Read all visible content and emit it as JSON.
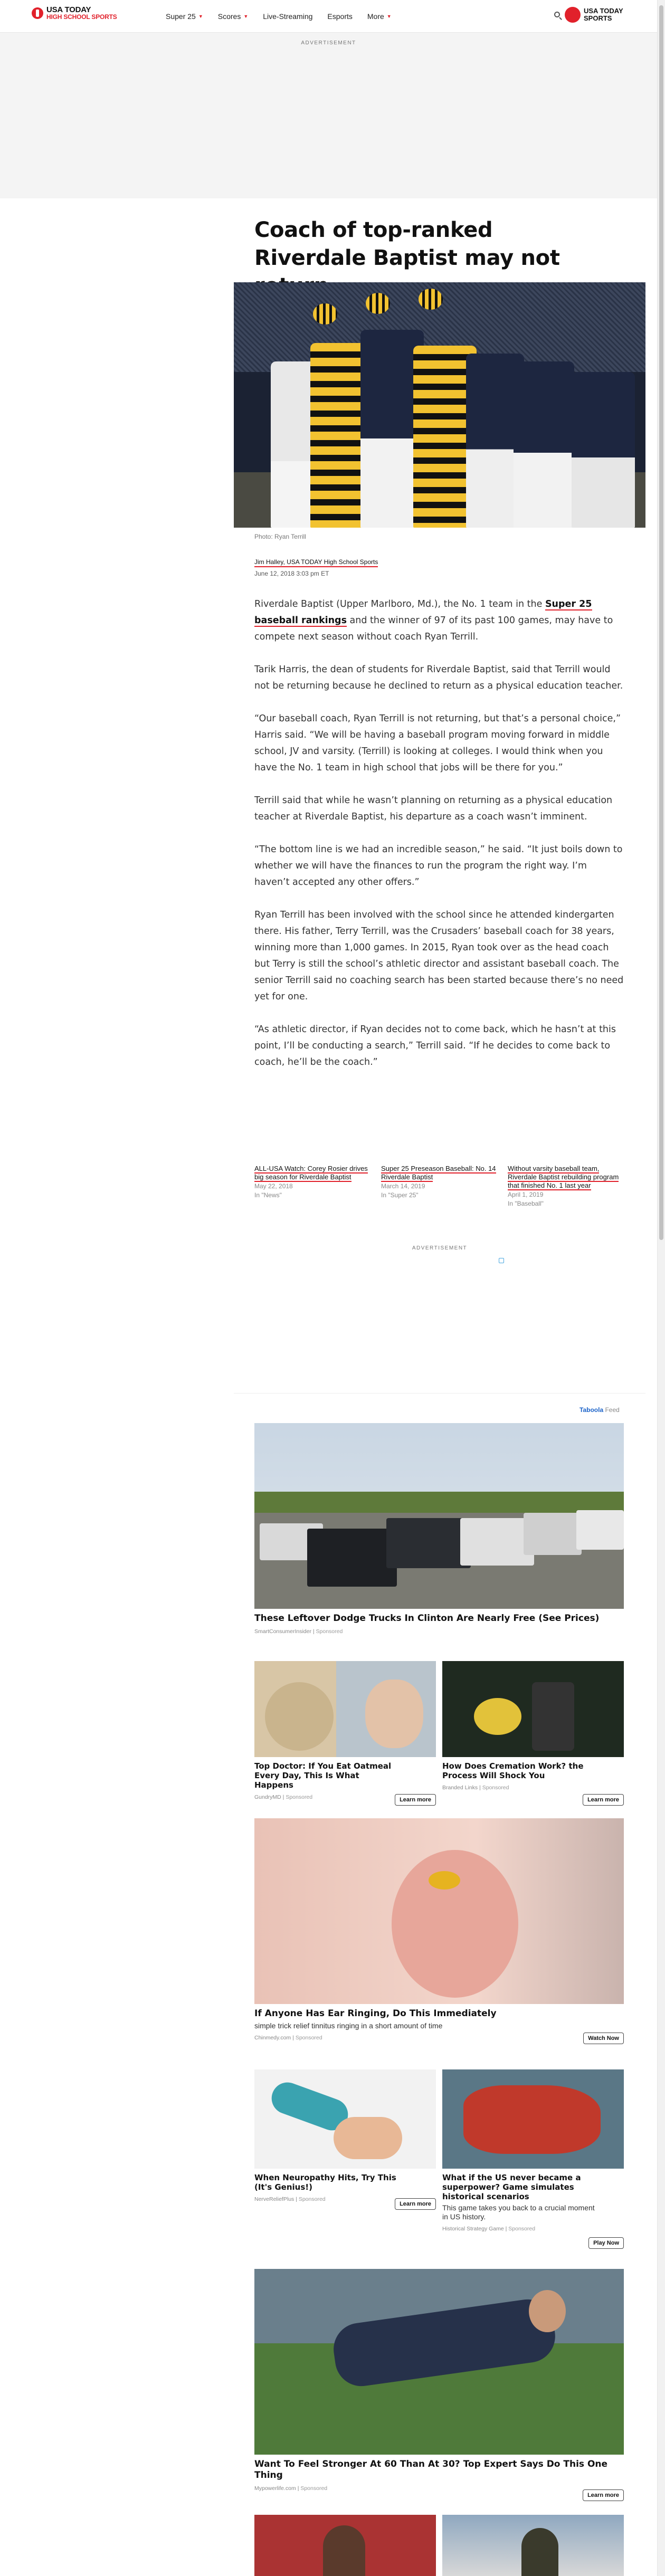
{
  "header": {
    "logo_line1": "USA TODAY",
    "logo_line2": "HIGH SCHOOL SPORTS",
    "nav": [
      {
        "label": "Super 25",
        "dropdown": true
      },
      {
        "label": "Scores",
        "dropdown": true
      },
      {
        "label": "Live-Streaming",
        "dropdown": false
      },
      {
        "label": "Esports",
        "dropdown": false
      },
      {
        "label": "More",
        "dropdown": true
      }
    ],
    "partner_line1": "USA TODAY",
    "partner_line2": "SPORTS"
  },
  "ads": {
    "top_label": "ADVERTISEMENT",
    "mid_label": "ADVERTISEMENT"
  },
  "article": {
    "headline": "Coach of top-ranked Riverdale Baptist may not return",
    "photo_credit": "Photo: Ryan Terrill",
    "author": "Jim Halley, USA TODAY High School Sports",
    "date": "June 12, 2018 3:03 pm ET",
    "p1_before": "Riverdale Baptist (Upper Marlboro, Md.), the No. 1 team in the ",
    "p1_link": "Super 25 baseball rankings",
    "p1_after": " and the winner of 97 of its past 100 games, may have to compete next season without coach Ryan Terrill.",
    "p2": "Tarik Harris, the dean of students for Riverdale Baptist, said that Terrill would not be returning because he declined to return as a physical education teacher.",
    "p3": "“Our baseball coach, Ryan Terrill is not returning, but that’s a personal choice,” Harris said. “We will be having a baseball program moving forward in middle school, JV and varsity. (Terrill) is looking at colleges. I would think when you have the No. 1 team in high school that jobs will be there for you.”",
    "p4": "Terrill said that while he wasn’t planning on returning as a physical education teacher at Riverdale Baptist, his departure as a coach wasn’t imminent.",
    "p5": "“The bottom line is we had an incredible season,” he said. “It just boils down to whether we will have the finances to run the program the right way. I’m haven’t accepted any other offers.”",
    "p6": "Ryan Terrill has been involved with the school since he attended kindergarten there. His father, Terry Terrill, was the Crusaders’ baseball coach for 38 years, winning more than 1,000 games. In 2015, Ryan took over as the head coach but Terry is still the school’s athletic director and assistant baseball coach. The senior Terrill said no coaching search has been started because there’s no need yet for one.",
    "p7": "“As athletic director, if Ryan decides not to come back, which he hasn’t at this point, I’ll be conducting a search,” Terrill said. “If he decides to come back to coach, he’ll be the coach.”"
  },
  "related": [
    {
      "title": "ALL-USA Watch: Corey Rosier drives big season for Riverdale Baptist",
      "date": "May 22, 2018",
      "category": "In \"News\""
    },
    {
      "title": "Super 25 Preseason Baseball: No. 14 Riverdale Baptist",
      "date": "March 14, 2019",
      "category": "In \"Super 25\""
    },
    {
      "title": "Without varsity baseball team, Riverdale Baptist rebuilding program that finished No. 1 last year",
      "date": "April 1, 2019",
      "category": "In \"Baseball\""
    }
  ],
  "taboola": {
    "brand": "Taboola",
    "feed": "Feed",
    "cards": [
      {
        "title": "These Leftover Dodge Trucks In Clinton Are Nearly Free (See Prices)",
        "source": "SmartConsumerInsider",
        "sponsored": "Sponsored"
      },
      {
        "title": "Top Doctor: If You Eat Oatmeal Every Day, This Is What Happens",
        "source": "GundryMD",
        "sponsored": "Sponsored",
        "cta": "Learn more"
      },
      {
        "title": "How Does Cremation Work? the Process Will Shock You",
        "source": "Branded Links",
        "sponsored": "Sponsored",
        "cta": "Learn more"
      },
      {
        "title": "If Anyone Has Ear Ringing, Do This Immediately",
        "desc": "simple trick relief tinnitus ringing in a short amount of time",
        "source": "Chinmedy.com",
        "sponsored": "Sponsored",
        "cta": "Watch Now"
      },
      {
        "title": "When Neuropathy Hits, Try This (It's Genius!)",
        "source": "NerveReliefPlus",
        "sponsored": "Sponsored",
        "cta": "Learn more"
      },
      {
        "title": "What if the US never became a superpower? Game simulates historical scenarios",
        "desc": "This game takes you back to a crucial moment in US history.",
        "source": "Historical Strategy Game",
        "sponsored": "Sponsored",
        "cta": "Play Now"
      },
      {
        "title": "Want To Feel Stronger At 60 Than At 30? Top Expert Says Do This One Thing",
        "source": "Mypowerlife.com",
        "sponsored": "Sponsored",
        "cta": "Learn more"
      }
    ]
  },
  "colors": {
    "accent_red": "#e1212b",
    "taboola_blue": "#1b63c9"
  }
}
